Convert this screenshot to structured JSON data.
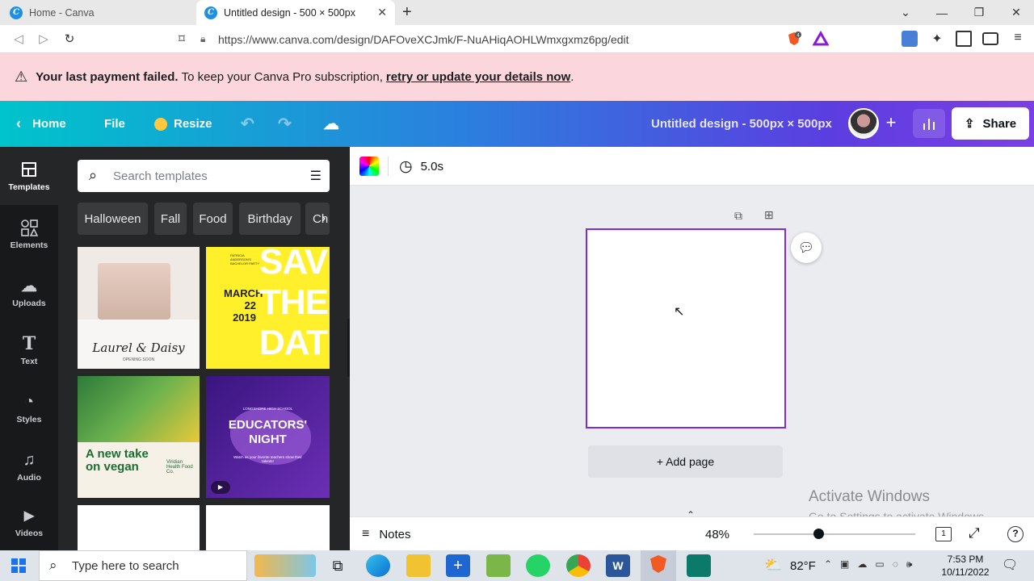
{
  "browser": {
    "tabs": [
      {
        "title": "Home - Canva",
        "active": false
      },
      {
        "title": "Untitled design - 500 × 500px",
        "active": true
      }
    ],
    "url": "https://www.canva.com/design/DAFOveXCJmk/F-NuAHiqAOHLWmxgxmz6pg/edit",
    "brave_badge": "4"
  },
  "banner": {
    "bold": "Your last payment failed.",
    "text": "To keep your Canva Pro subscription,",
    "link": "retry or update your details now",
    "end": "."
  },
  "header": {
    "home": "Home",
    "file": "File",
    "resize": "Resize",
    "design_title": "Untitled design - 500px × 500px",
    "share": "Share"
  },
  "rail": [
    {
      "label": "Templates",
      "icon": "templates-icon"
    },
    {
      "label": "Elements",
      "icon": "elements-icon"
    },
    {
      "label": "Uploads",
      "icon": "uploads-icon"
    },
    {
      "label": "Text",
      "icon": "text-icon"
    },
    {
      "label": "Styles",
      "icon": "styles-icon"
    },
    {
      "label": "Audio",
      "icon": "audio-icon"
    },
    {
      "label": "Videos",
      "icon": "videos-icon"
    }
  ],
  "panel": {
    "search_placeholder": "Search templates",
    "chips": [
      "Halloween",
      "Fall",
      "Food",
      "Birthday",
      "Ch"
    ],
    "templates": [
      {
        "name": "Laurel & Daisy",
        "sub": "OPENING SOON"
      },
      {
        "name": "SAVE THE DATE",
        "date": "MARCH 22 2019",
        "top": "PATRICIA ANDERSON'S BACHELOR PARTY"
      },
      {
        "name": "A new take on vegan",
        "brand": "Viridian Health Food Co."
      },
      {
        "name": "EDUCATORS' NIGHT",
        "top": "LONGSHORE HIGH SCHOOL",
        "sub": "Watch as your favorite teachers show their talents!"
      }
    ]
  },
  "editor": {
    "duration": "5.0s",
    "add_page": "+ Add page",
    "notes": "Notes",
    "zoom": "48%",
    "zoom_fraction": 0.4,
    "page_count": "1"
  },
  "watermark": {
    "line1": "Activate Windows",
    "line2": "Go to Settings to activate Windows."
  },
  "taskbar": {
    "search": "Type here to search",
    "weather": "82°F",
    "time": "7:53 PM",
    "date": "10/11/2022"
  },
  "colors": {
    "accent": "#7d2ae8",
    "banner": "#fcd6dd",
    "rail": "#18191b",
    "panel": "#252627"
  }
}
